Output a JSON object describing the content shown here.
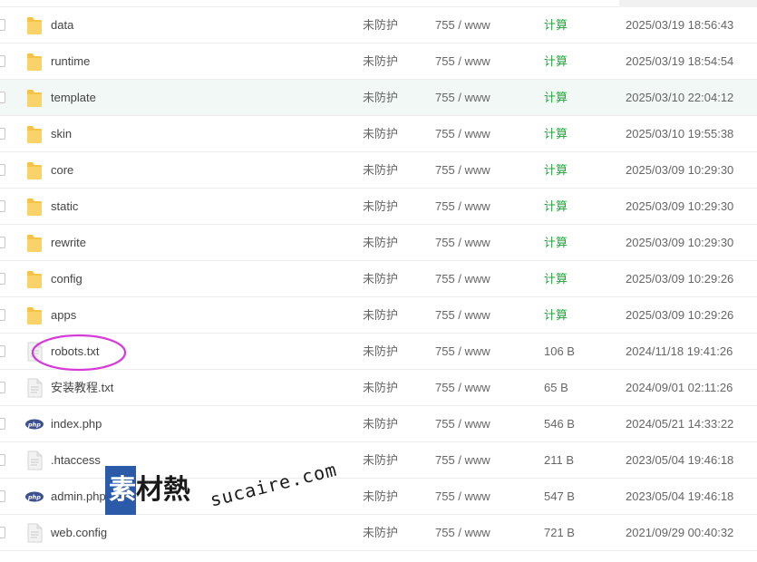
{
  "files": [
    {
      "name": "data",
      "type": "folder",
      "protect": "未防护",
      "perm": "755 / www",
      "size": "计算",
      "size_is_action": true,
      "time": "2025/03/19 18:56:43"
    },
    {
      "name": "runtime",
      "type": "folder",
      "protect": "未防护",
      "perm": "755 / www",
      "size": "计算",
      "size_is_action": true,
      "time": "2025/03/19 18:54:54"
    },
    {
      "name": "template",
      "type": "folder",
      "protect": "未防护",
      "perm": "755 / www",
      "size": "计算",
      "size_is_action": true,
      "time": "2025/03/10 22:04:12",
      "highlight": true
    },
    {
      "name": "skin",
      "type": "folder",
      "protect": "未防护",
      "perm": "755 / www",
      "size": "计算",
      "size_is_action": true,
      "time": "2025/03/10 19:55:38"
    },
    {
      "name": "core",
      "type": "folder",
      "protect": "未防护",
      "perm": "755 / www",
      "size": "计算",
      "size_is_action": true,
      "time": "2025/03/09 10:29:30"
    },
    {
      "name": "static",
      "type": "folder",
      "protect": "未防护",
      "perm": "755 / www",
      "size": "计算",
      "size_is_action": true,
      "time": "2025/03/09 10:29:30"
    },
    {
      "name": "rewrite",
      "type": "folder",
      "protect": "未防护",
      "perm": "755 / www",
      "size": "计算",
      "size_is_action": true,
      "time": "2025/03/09 10:29:30"
    },
    {
      "name": "config",
      "type": "folder",
      "protect": "未防护",
      "perm": "755 / www",
      "size": "计算",
      "size_is_action": true,
      "time": "2025/03/09 10:29:26"
    },
    {
      "name": "apps",
      "type": "folder",
      "protect": "未防护",
      "perm": "755 / www",
      "size": "计算",
      "size_is_action": true,
      "time": "2025/03/09 10:29:26"
    },
    {
      "name": "robots.txt",
      "type": "text",
      "protect": "未防护",
      "perm": "755 / www",
      "size": "106 B",
      "size_is_action": false,
      "time": "2024/11/18 19:41:26"
    },
    {
      "name": "安装教程.txt",
      "type": "text",
      "protect": "未防护",
      "perm": "755 / www",
      "size": "65 B",
      "size_is_action": false,
      "time": "2024/09/01 02:11:26"
    },
    {
      "name": "index.php",
      "type": "php",
      "protect": "未防护",
      "perm": "755 / www",
      "size": "546 B",
      "size_is_action": false,
      "time": "2024/05/21 14:33:22"
    },
    {
      "name": ".htaccess",
      "type": "text",
      "protect": "未防护",
      "perm": "755 / www",
      "size": "211 B",
      "size_is_action": false,
      "time": "2023/05/04 19:46:18"
    },
    {
      "name": "admin.php",
      "type": "php",
      "protect": "未防护",
      "perm": "755 / www",
      "size": "547 B",
      "size_is_action": false,
      "time": "2023/05/04 19:46:18"
    },
    {
      "name": "web.config",
      "type": "text",
      "protect": "未防护",
      "perm": "755 / www",
      "size": "721 B",
      "size_is_action": false,
      "time": "2021/09/29 00:40:32"
    }
  ],
  "icons": {
    "folder": "folder-icon",
    "text": "text-file-icon",
    "php": "php-file-icon",
    "php_badge": "php"
  },
  "colors": {
    "calc_link": "#20a53a",
    "highlight_row": "#f2f8f6",
    "annotation": "#d63bd8",
    "folder": "#f6c344",
    "watermark_box": "#2b5aa8"
  },
  "watermark": {
    "cn": "素材熱",
    "en": "sucaire.com"
  }
}
